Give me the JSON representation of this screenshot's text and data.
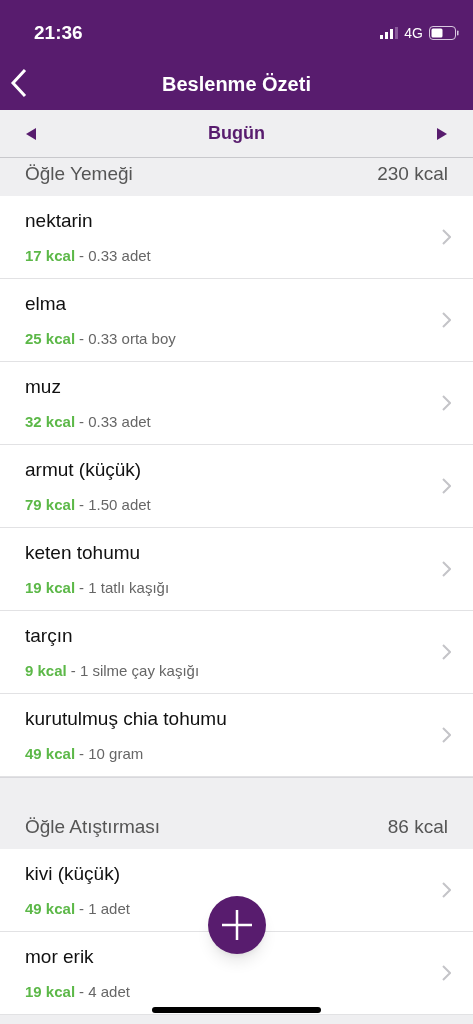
{
  "status_bar": {
    "time": "21:36",
    "network": "4G"
  },
  "nav": {
    "title": "Beslenme Özeti"
  },
  "date_bar": {
    "label": "Bugün"
  },
  "sections": [
    {
      "title": "Öğle Yemeği",
      "total": "230 kcal",
      "items": [
        {
          "name": "nektarin",
          "kcal": "17 kcal",
          "serving": "- 0.33 adet"
        },
        {
          "name": "elma",
          "kcal": "25 kcal",
          "serving": "- 0.33 orta boy"
        },
        {
          "name": "muz",
          "kcal": "32 kcal",
          "serving": "- 0.33 adet"
        },
        {
          "name": "armut (küçük)",
          "kcal": "79 kcal",
          "serving": "- 1.50 adet"
        },
        {
          "name": "keten tohumu",
          "kcal": "19 kcal",
          "serving": "- 1 tatlı kaşığı"
        },
        {
          "name": "tarçın",
          "kcal": "9 kcal",
          "serving": "- 1 silme çay kaşığı"
        },
        {
          "name": "kurutulmuş chia tohumu",
          "kcal": "49 kcal",
          "serving": "- 10 gram"
        }
      ]
    },
    {
      "title": "Öğle Atıştırması",
      "total": "86 kcal",
      "items": [
        {
          "name": "kivi (küçük)",
          "kcal": "49 kcal",
          "serving": "- 1 adet"
        },
        {
          "name": "mor erik",
          "kcal": "19 kcal",
          "serving": "- 4 adet"
        }
      ]
    }
  ]
}
